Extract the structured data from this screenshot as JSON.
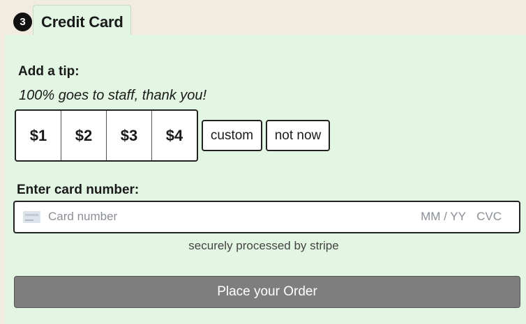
{
  "step": {
    "number": "3",
    "title": "Credit Card"
  },
  "tip": {
    "heading": "Add a tip:",
    "subheading": "100% goes to staff, thank you!",
    "options": [
      "$1",
      "$2",
      "$3",
      "$4"
    ],
    "custom_label": "custom",
    "not_now_label": "not now"
  },
  "card": {
    "heading": "Enter card number:",
    "number_placeholder": "Card number",
    "expiry_placeholder": "MM / YY",
    "cvc_placeholder": "CVC",
    "secure_note": "securely processed by stripe",
    "icon": "credit-card-icon"
  },
  "order": {
    "button_label": "Place your Order"
  },
  "colors": {
    "page_background": "#f2ebe0",
    "panel_background": "#e3f5e3",
    "order_button": "#7e7e7e"
  }
}
